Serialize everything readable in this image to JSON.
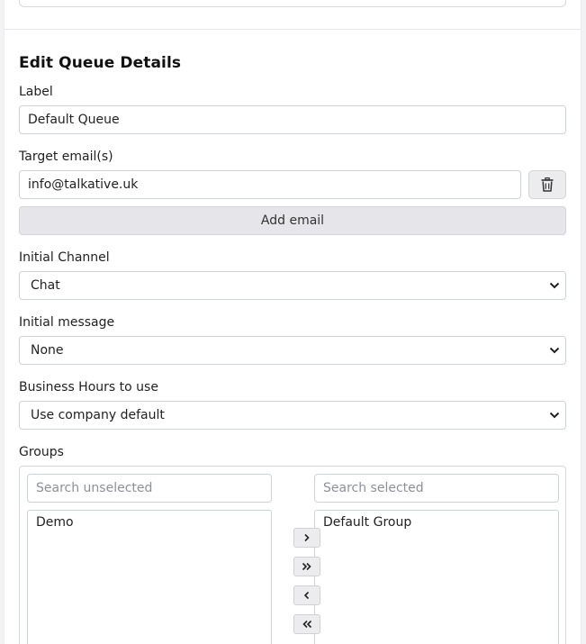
{
  "form": {
    "title": "Edit Queue Details",
    "label_field": {
      "label": "Label",
      "value": "Default Queue"
    },
    "target_emails": {
      "label": "Target email(s)",
      "emails": [
        "info@talkative.uk"
      ],
      "add_button_label": "Add email"
    },
    "initial_channel": {
      "label": "Initial Channel",
      "value": "Chat"
    },
    "initial_message": {
      "label": "Initial message",
      "value": "None"
    },
    "business_hours": {
      "label": "Business Hours to use",
      "value": "Use company default"
    },
    "groups": {
      "label": "Groups",
      "search_unselected_placeholder": "Search unselected",
      "search_selected_placeholder": "Search selected",
      "unselected": [
        "Demo"
      ],
      "selected": [
        "Default Group"
      ]
    }
  },
  "icons": {
    "delete": "trash-icon",
    "select": "chevron-down-icon",
    "move_right": "chevron-right-icon",
    "move_all_right": "double-chevron-right-icon",
    "move_left": "chevron-left-icon",
    "move_all_left": "double-chevron-left-icon"
  }
}
